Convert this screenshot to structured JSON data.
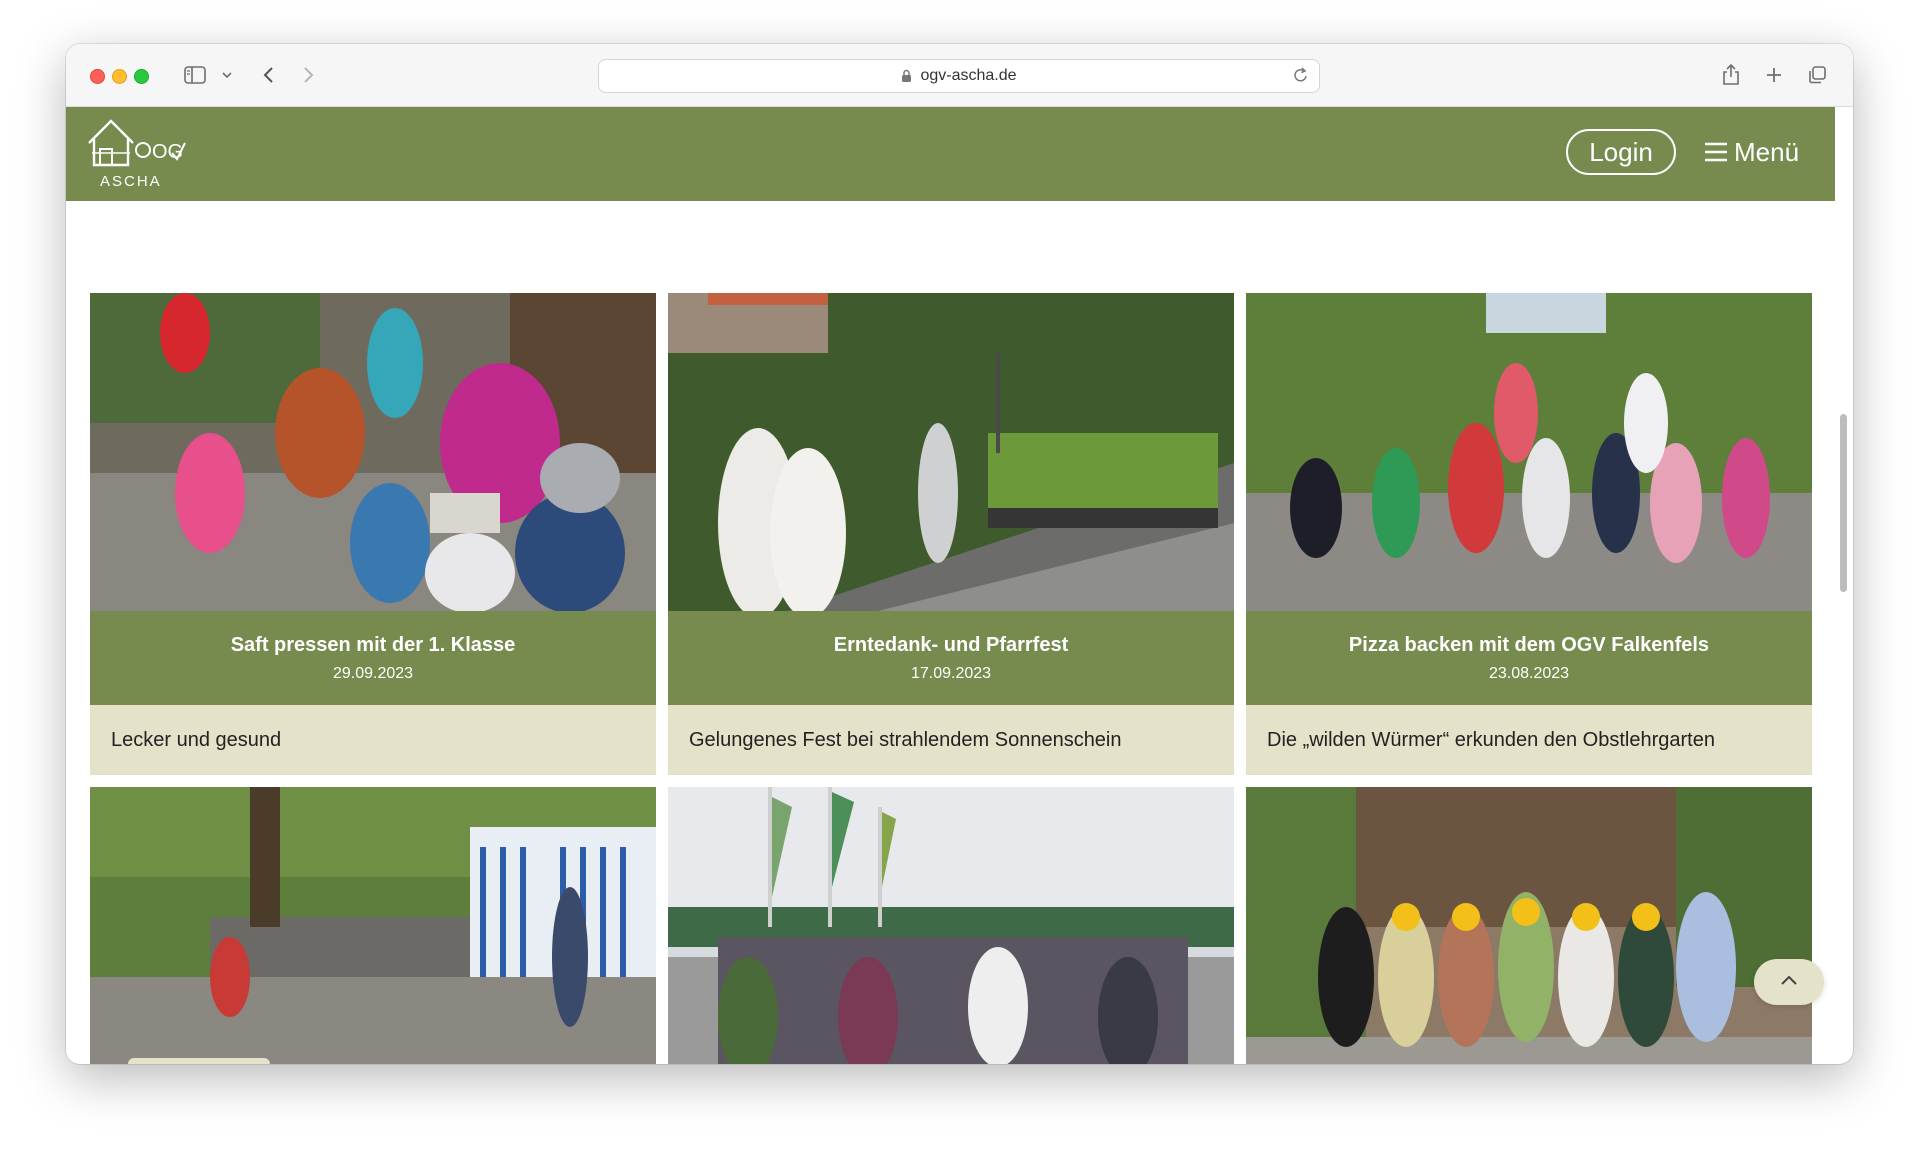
{
  "browser": {
    "url": "ogv-ascha.de"
  },
  "header": {
    "logo_text": "ASCHA",
    "logo_letters": "OG",
    "login_label": "Login",
    "menu_label": "Menü"
  },
  "cards": [
    {
      "title": "Saft pressen mit der 1. Klasse",
      "date": "29.09.2023",
      "teaser": "Lecker und gesund"
    },
    {
      "title": "Erntedank- und Pfarrfest",
      "date": "17.09.2023",
      "teaser": "Gelungenes Fest bei strahlendem Sonnenschein"
    },
    {
      "title": "Pizza backen mit dem OGV Falkenfels",
      "date": "23.08.2023",
      "teaser": "Die „wilden Würmer“ erkunden den Obstlehrgarten"
    }
  ],
  "colors": {
    "brand_green": "#778b4e",
    "card_beige": "#e4e2c9"
  }
}
